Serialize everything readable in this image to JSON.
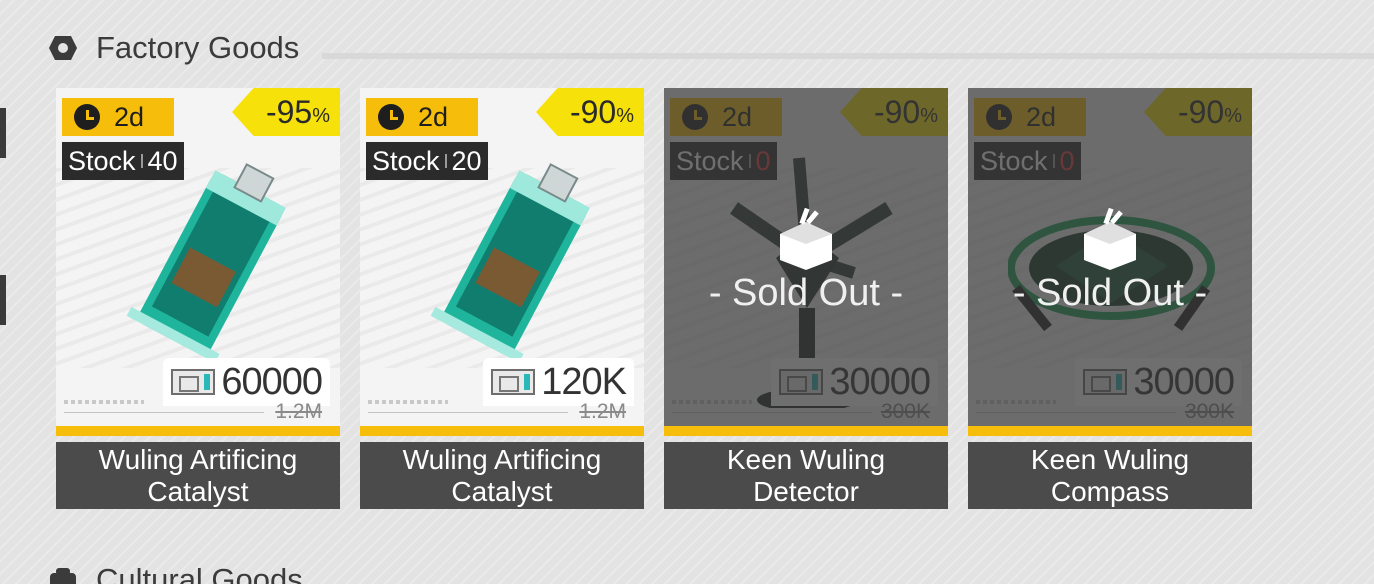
{
  "sections": [
    {
      "title": "Factory Goods"
    },
    {
      "title": "Cultural Goods"
    }
  ],
  "soldout_label": "- Sold Out -",
  "cards": [
    {
      "timer": "2d",
      "discount": "-95",
      "discount_unit": "%",
      "stock_label": "Stock",
      "stock": "40",
      "price": "60000",
      "original_price": "1.2M",
      "name": "Wuling Artificing Catalyst",
      "sold_out": false,
      "art": "catalyst"
    },
    {
      "timer": "2d",
      "discount": "-90",
      "discount_unit": "%",
      "stock_label": "Stock",
      "stock": "20",
      "price": "120K",
      "original_price": "1.2M",
      "name": "Wuling Artificing Catalyst",
      "sold_out": false,
      "art": "catalyst"
    },
    {
      "timer": "2d",
      "discount": "-90",
      "discount_unit": "%",
      "stock_label": "Stock",
      "stock": "0",
      "price": "30000",
      "original_price": "300K",
      "name": "Keen Wuling Detector",
      "sold_out": true,
      "art": "detector"
    },
    {
      "timer": "2d",
      "discount": "-90",
      "discount_unit": "%",
      "stock_label": "Stock",
      "stock": "0",
      "price": "30000",
      "original_price": "300K",
      "name": "Keen Wuling Compass",
      "sold_out": true,
      "art": "compass"
    }
  ],
  "colors": {
    "accent_yellow": "#f6bd0a",
    "discount_yellow": "#f6e20a",
    "name_bg": "#4b4b4b",
    "stock_zero": "#e83b3b"
  }
}
